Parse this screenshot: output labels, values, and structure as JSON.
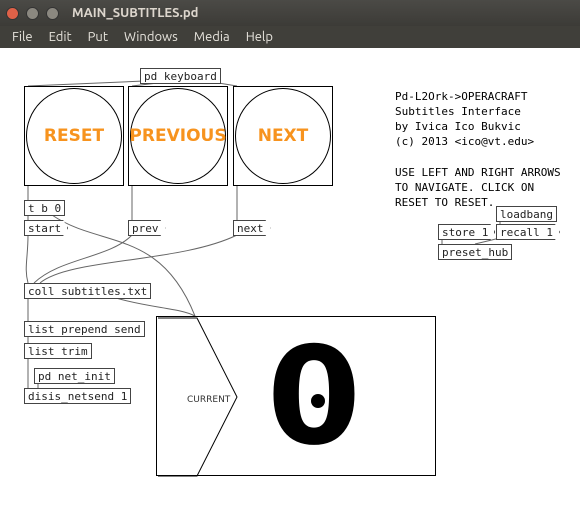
{
  "window": {
    "title": "MAIN_SUBTITLES.pd"
  },
  "menu": {
    "file": "File",
    "edit": "Edit",
    "put": "Put",
    "windows": "Windows",
    "media": "Media",
    "help": "Help"
  },
  "header_obj": "pd keyboard",
  "bangs": {
    "reset": "RESET",
    "prev": "PREVIOUS",
    "next": "NEXT"
  },
  "info": {
    "line1": "Pd-L2Ork->OPERACRAFT",
    "line2": "Subtitles Interface",
    "line3": "by Ivica Ico Bukvic",
    "line4": "(c) 2013 <ico@vt.edu>",
    "nav": "USE LEFT AND RIGHT ARROWS\nTO NAVIGATE. CLICK ON\nRESET TO RESET."
  },
  "objs": {
    "tb0": "t b 0",
    "start": "start",
    "prev": "prev",
    "next": "next",
    "loadbang": "loadbang",
    "store": "store 1",
    "recall": "recall 1",
    "preset_hub": "preset_hub",
    "coll": "coll subtitles.txt",
    "list_prepend": "list prepend send",
    "list_trim": "list trim",
    "pd_net": "pd net_init",
    "disis": "disis_netsend 1"
  },
  "current_label": "CURRENT",
  "current_value": "0"
}
